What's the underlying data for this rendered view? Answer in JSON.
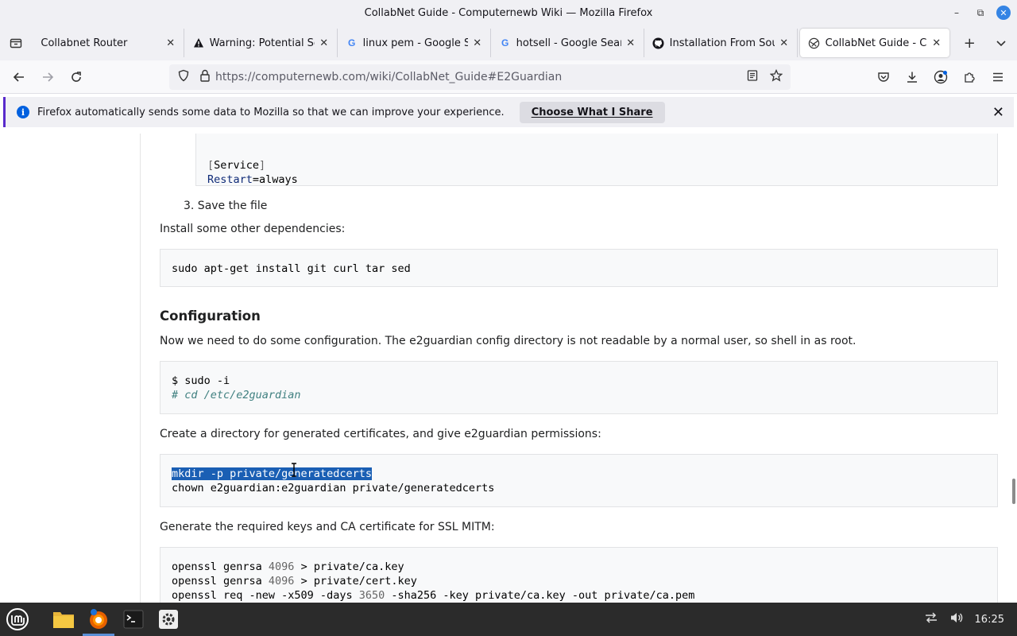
{
  "window": {
    "title": "CollabNet Guide - Computernewb Wiki — Mozilla Firefox"
  },
  "tabs": [
    {
      "title": "Collabnet Router",
      "icon": "none",
      "active": false
    },
    {
      "title": "Warning: Potential Sec",
      "icon": "warning-icon",
      "active": false
    },
    {
      "title": "linux pem - Google Sea",
      "icon": "google-icon",
      "active": false
    },
    {
      "title": "hotsell - Google Search",
      "icon": "google-icon",
      "active": false
    },
    {
      "title": "Installation From Sourc",
      "icon": "github-icon",
      "active": false
    },
    {
      "title": "CollabNet Guide - Com",
      "icon": "wiki-icon",
      "active": true
    }
  ],
  "navbar": {
    "url": "https://computernewb.com/wiki/CollabNet_Guide#E2Guardian"
  },
  "notification": {
    "message": "Firefox automatically sends some data to Mozilla so that we can improve your experience.",
    "button": "Choose What I Share"
  },
  "article": {
    "service_block": {
      "line1_bracket_open": "[",
      "line1_word": "Service",
      "line1_bracket_close": "]",
      "line2_key": "Restart",
      "line2_rest": "=always"
    },
    "step3": "3. Save the file",
    "deps_intro": "Install some other dependencies:",
    "deps_cmd": "sudo apt-get install git curl tar sed",
    "config_heading": "Configuration",
    "config_intro": "Now we need to do some configuration. The e2guardian config directory is not readable by a normal user, so shell in as root.",
    "root_cmd1": "$ sudo -i",
    "root_cmd2": "# cd /etc/e2guardian",
    "certs_intro": "Create a directory for generated certificates, and give e2guardian permissions:",
    "certs_cmd1": "mkdir -p private/generatedcerts",
    "certs_cmd2": "chown e2guardian:e2guardian private/generatedcerts",
    "keys_intro": "Generate the required keys and CA certificate for SSL MITM:",
    "keys_lines": [
      {
        "pre": "openssl genrsa ",
        "num": "4096",
        "post": " > private/ca.key"
      },
      {
        "pre": "openssl genrsa ",
        "num": "4096",
        "post": " > private/cert.key"
      },
      {
        "pre": "openssl req -new -x509 -days ",
        "num": "3650",
        "post": " -sha256 -key private/ca.key -out private/ca.pem"
      }
    ]
  },
  "taskbar": {
    "time": "16:25"
  },
  "colors": {
    "selection": "#1a5fb4",
    "notification_accent": "#592acb",
    "close_button": "#3584e4"
  }
}
